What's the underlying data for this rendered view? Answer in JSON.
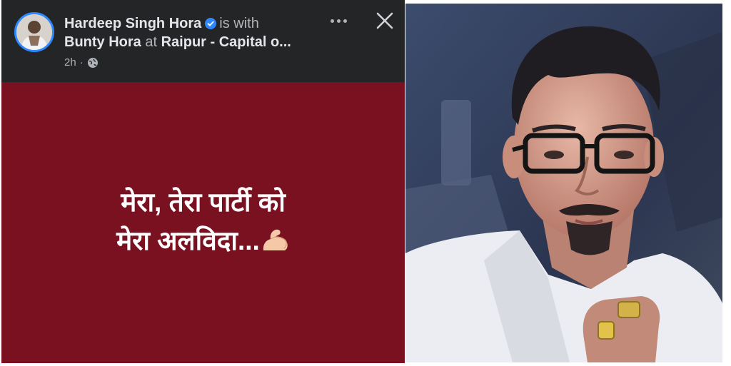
{
  "post": {
    "author": "Hardeep Singh Hora",
    "with_text": "is with",
    "tagged_person": "Bunty Hora",
    "at_text": "at",
    "location": "Raipur - Capital o...",
    "time": "2h",
    "text_line1": "मेरा, तेरा पार्टी को",
    "text_line2": "मेरा अलविदा...",
    "body_color": "#7a1120"
  },
  "icons": {
    "verified": "verified-badge-icon",
    "privacy": "globe-icon",
    "more": "more-options-icon",
    "close": "close-icon",
    "emoji": "flexed-biceps-emoji"
  }
}
